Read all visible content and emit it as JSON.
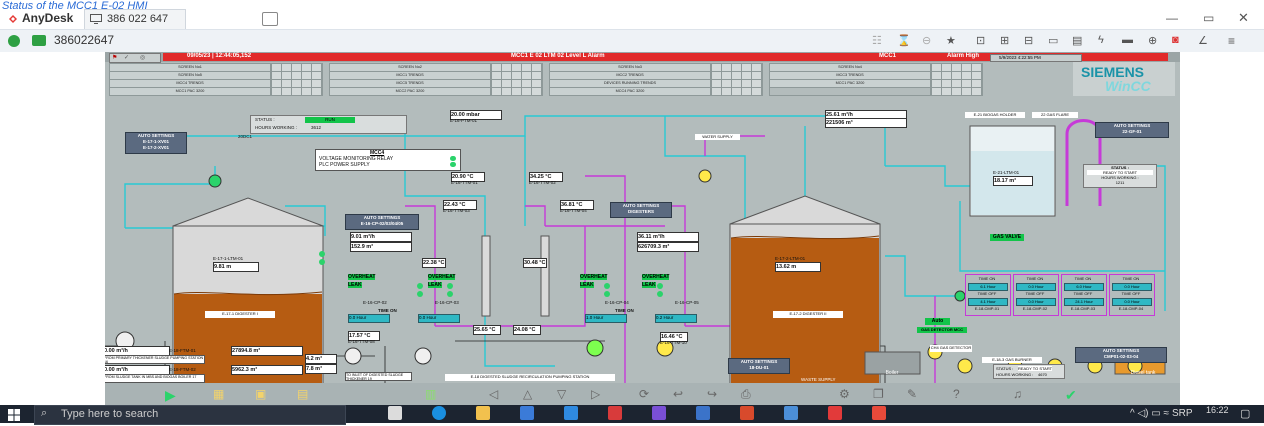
{
  "caption": "Status of the MCC1 E-02 HMI",
  "titlebar": {
    "app_name": "AnyDesk",
    "session_id": "386 022 647"
  },
  "toolbar": {
    "address": "386022647"
  },
  "hmi": {
    "alarm_bar": {
      "date_time": "09/05/23 | 12:44:05,152",
      "message": "MCC1 E 02 LTM 02 Level L Alarm",
      "station": "MCC1",
      "status": "Alarm High",
      "clock": "5/9/2023 4:22:55 PM"
    },
    "nav_rows": [
      [
        "SCREEN No1",
        "SCREEN No2",
        "SCREEN No3",
        "SCREEN No4"
      ],
      [
        "SCREEN No5",
        "MCC1 TRENDS",
        "MCC2 TRENDS",
        "MCC3 TRENDS"
      ],
      [
        "MCC4 TRENDS",
        "MCC5 TRENDS",
        "DEVICES RUNNING TRENDS",
        "MCC1 PAC 3200"
      ],
      [
        "MCC1 PAC 3200",
        "MCC2 PAC 3200",
        "MCC4 PAC 3200",
        ""
      ]
    ],
    "logo": {
      "brand": "SIEMENS",
      "product": "WinCC"
    },
    "status_panel": {
      "status_label": "STATUS :",
      "status_value": "RUN",
      "hours_label": "HOURS WORKING :",
      "hours_value": "3612",
      "device": "20DC1"
    },
    "mcc4": {
      "title": "MCC4",
      "line1": "VOLTAGE MONITORING RELAY",
      "line2": "PLC POWER SUPPLY"
    },
    "auto_settings": {
      "left": [
        "AUTO SETTINGS",
        "E-17-1-XV01",
        "E-17-2-XV01"
      ],
      "cp": [
        "AUTO SETTINGS",
        "E-16-CP-02/03/04/05"
      ],
      "digesters": [
        "AUTO SETTINGS",
        "DIGESTERS"
      ],
      "gf": [
        "AUTO SETTINGS",
        "22-GF-01"
      ],
      "cmp": [
        "AUTO SETTINGS",
        "CMP01-02-03-04"
      ],
      "du": [
        "AUTO SETTINGS",
        "18-DU-01"
      ]
    },
    "readings": {
      "pressure_top": "20.00 mbar",
      "pressure_tag": "E-16-PTM-01",
      "flow_gas": "25.61 m³/h",
      "flow_gas_total": "221506 m³",
      "temp_1": "20.90 °C",
      "temp_1_tag": "E-16-TTM-01",
      "temp_2": "34.25 °C",
      "temp_2_tag": "E-16-TTM-02",
      "temp_3": "22.43 °C",
      "temp_3_tag": "E-16-TTM-03",
      "temp_4": "36.81 °C",
      "temp_4_tag": "E-16-TTM-04",
      "flow_left": "9.01 m³/h",
      "flow_left_total": "152.9 m³",
      "flow_right": "36.11 m³/h",
      "flow_right_total": "626709.3 m³",
      "temp_mid_l": "22.38 °C",
      "temp_mid_r": "30.48 °C",
      "level_left": "9.81 m",
      "level_left_tag": "E-17-1-LTM-01",
      "level_right": "13.62 m",
      "level_right_tag": "E-17-2-LTM-01",
      "gas_level": "18.17 m³",
      "gas_level_tag": "E-21-LTM-01",
      "temp_bottom_l": "17.57 °C",
      "temp_bottom_l_tag": "E-16-TTM-08",
      "temp_b2": "25.65 °C",
      "temp_b3": "24.08 °C",
      "temp_b4": "16.46 °C",
      "temp_b4_tag": "E-16-TTM-10",
      "flow_primary": "0.00 m³/h",
      "flow_primary_tag": "E-18-FTM-01",
      "flow_primary_total": "27894.8 m³",
      "flow_primary_desc": "FROM PRIMARY THICKENER SLUDGE PUMPING STATION 16",
      "flow_sludge": "0.00 m³/h",
      "flow_sludge_tag": "E-18-FTM-02",
      "flow_sludge_total": "5962.3 m³",
      "flow_sludge_desc": "FROM SLUDGE TANK IN MBS AND BIOGAS BOILER 17",
      "inlet_a": "4.2 m³",
      "inlet_b": "7.8 m³",
      "inlet_desc": "TO INLET OF DIGESTED SLUDGE THICKENER 19"
    },
    "labels": {
      "water_supply": "WATER SUPPLY",
      "gas_valve": "GAS VALVE",
      "biogas_holder": "E-21 BIOGAS HOLDER",
      "gas_flare": "22 GAS FLARE",
      "digester_left": "E-17-1 DIGESTER I",
      "digester_right": "E-17-2 DIGESTER II",
      "recirc": "E-18 DIGESTED SLUDGE RECIRCULATION PUMPING STATION",
      "boiler": "Boiler",
      "diesel_tank": "Diesel tank",
      "waste_supply": "WASTE SUPPLY",
      "gas_detector": "CH4 GAS DETECTOR",
      "gas_burner": "E-18-3 GAS BURNER",
      "auto": "Auto",
      "gas_detector_status": "GAS DETECTOR MCC",
      "gf_status": [
        "STATUS :",
        "READY TO START",
        "HOURS WORKING :",
        "1211"
      ],
      "du_status": [
        "STATUS :",
        "READY TO START",
        "HOURS WORKING :",
        "4670"
      ],
      "overheat": "OVERHEAT",
      "leak": "LEAK",
      "time_on": "TIME ON",
      "time_off": "TIME OFF"
    },
    "pump_tags_left": [
      "E-16-CP-02",
      "E-16-CP-03"
    ],
    "pump_tags_right": [
      "E-16-CP-04",
      "E-16-CP-05"
    ],
    "timers_left": [
      "0.0 Hour",
      "0.0 Hour"
    ],
    "timers_right": [
      "1.0 Hour",
      "0.2 Hour"
    ],
    "cmp_blocks": [
      {
        "on": "6.1 Hour",
        "off": "4.1 Hour",
        "tag": "E-18-CMP-01"
      },
      {
        "on": "0.0 Hour",
        "off": "0.0 Hour",
        "tag": "E-18-CMP-02"
      },
      {
        "on": "6.0 Hour",
        "off": "24.1 Hour",
        "tag": "E-18-CMP-03"
      },
      {
        "on": "0.0 Hour",
        "off": "0.0 Hour",
        "tag": "E-18-CMP-04"
      }
    ]
  },
  "taskbar": {
    "search_placeholder": "Type here to search",
    "language": "SRP",
    "time": "16:22",
    "date": "9.5.2023"
  },
  "colors": {
    "alarm_red": "#e12a2a",
    "pipe_cyan": "#29c9d3",
    "pipe_magenta": "#c63ad8",
    "sludge": "#b65c12",
    "pump_yellow": "#ffe94a",
    "pump_green": "#7dff4f"
  }
}
